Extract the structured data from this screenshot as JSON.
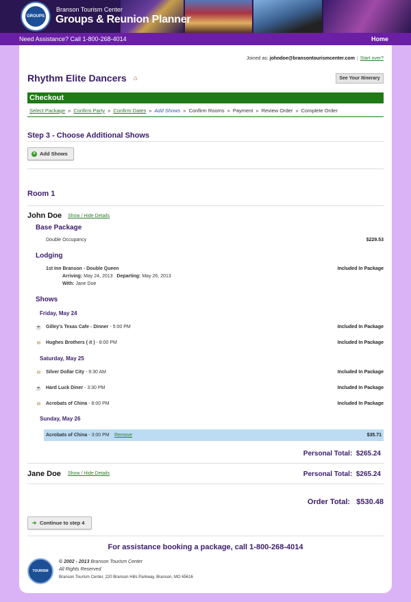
{
  "header": {
    "logo_text": "GROUPS",
    "brand_top": "Branson Tourism Center",
    "brand_main": "Groups & Reunion Planner"
  },
  "assist_bar": {
    "text": "Need Assistance? Call 1-800-268-4014",
    "home_label": "Home"
  },
  "account": {
    "joined_prefix": "Joined as:",
    "email": "johndoe@bransontourismcenter.com",
    "start_over": "Start over?"
  },
  "page": {
    "title": "Rhythm Elite Dancers",
    "itinerary_button": "See Your Itinerary"
  },
  "checkout": {
    "title": "Checkout",
    "steps": [
      {
        "label": "Select Package",
        "state": "done"
      },
      {
        "label": "Confirm Party",
        "state": "done"
      },
      {
        "label": "Confirm Dates",
        "state": "done"
      },
      {
        "label": "Add Shows",
        "state": "current"
      },
      {
        "label": "Confirm Rooms",
        "state": "todo"
      },
      {
        "label": "Payment",
        "state": "todo"
      },
      {
        "label": "Review Order",
        "state": "todo"
      },
      {
        "label": "Complete Order",
        "state": "todo"
      }
    ],
    "arrow": "»"
  },
  "step3": {
    "title": "Step 3 - Choose Additional Shows",
    "add_shows_button": "Add Shows"
  },
  "room": {
    "title": "Room 1",
    "toggle_label": "Show / Hide Details",
    "guest1": {
      "name": "John Doe",
      "base_package_heading": "Base Package",
      "base_package_item": "Double Occupancy",
      "base_package_price": "$229.53",
      "lodging_heading": "Lodging",
      "hotel": "1st Inn Branson - Double Queen",
      "hotel_status": "Included In Package",
      "arriving_label": "Arriving:",
      "arriving_date": "May 24, 2013",
      "departing_label": "Departing:",
      "departing_date": "May 26, 2013",
      "with_label": "With:",
      "with_name": "Jane Doe",
      "shows_heading": "Shows",
      "days": [
        {
          "label": "Friday, May 24"
        },
        {
          "label": "Saturday, May 25"
        },
        {
          "label": "Sunday, May 26"
        }
      ],
      "shows": [
        {
          "icon": "dinner-icon",
          "name": "Gilley's Texas Cafe - Dinner",
          "time": "5:00 PM",
          "status": "Included In Package"
        },
        {
          "icon": "ticket-icon",
          "name": "Hughes Brothers ( it )",
          "time": "8:00 PM",
          "status": "Included In Package"
        },
        {
          "icon": "ticket-icon",
          "name": "Silver Dollar City",
          "time": "9:30 AM",
          "status": "Included In Package"
        },
        {
          "icon": "dinner-icon",
          "name": "Hard Luck Diner",
          "time": "3:30 PM",
          "status": "Included In Package"
        },
        {
          "icon": "ticket-icon",
          "name": "Acrobats of China",
          "time": "8:00 PM",
          "status": "Included In Package"
        }
      ],
      "extra_show": {
        "name": "Acrobats of China",
        "time": "3:00 PM",
        "remove_label": "Remove",
        "price": "$35.71"
      },
      "personal_total_label": "Personal Total:",
      "personal_total": "$265.24"
    },
    "guest2": {
      "name": "Jane Doe",
      "personal_total_label": "Personal Total:",
      "personal_total": "$265.24"
    }
  },
  "order": {
    "total_label": "Order Total:",
    "total": "$530.48",
    "continue_button": "Continue to step 4"
  },
  "footer": {
    "help": "For assistance booking a package, call 1-800-268-4014",
    "logo_text": "TOURISM",
    "copyright_years": "© 2002 - 2013",
    "copyright_name": "Branson Tourism Center",
    "rights": "All Rights Reserved",
    "address": "Branson Tourism Center, 220 Branson Hills Parkway, Branson, MO 65616"
  },
  "colors": {
    "page_bg": "#d9b3f5",
    "assist_bar": "#6a1fa5",
    "checkout_bar": "#1e7a15",
    "heading_purple": "#3a1a6a",
    "link_green": "#2a7a2a",
    "highlight_row": "#bcdcf4"
  }
}
